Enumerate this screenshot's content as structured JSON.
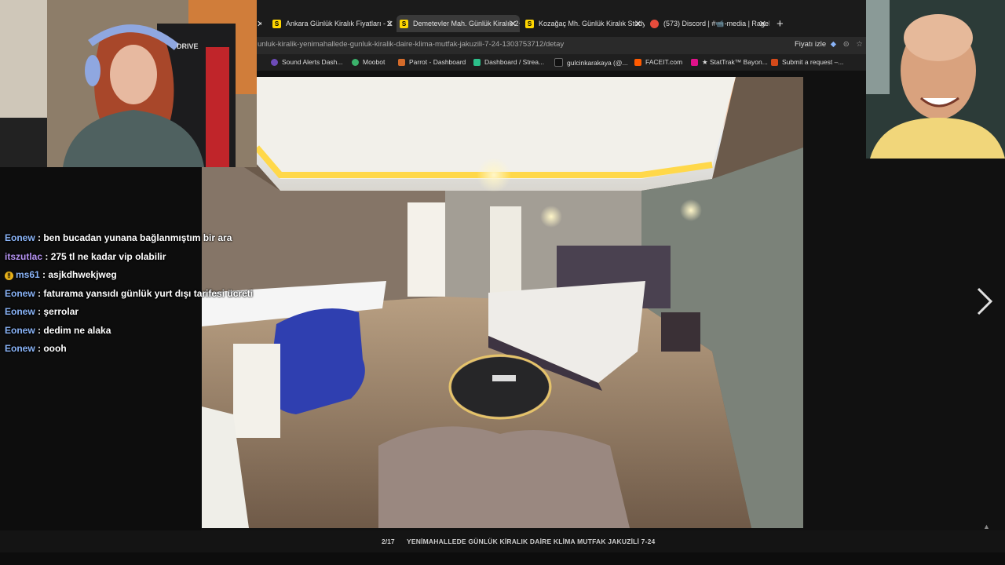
{
  "browser": {
    "tabs": [
      {
        "label": "Ankara Günlük Kiralık Fiyatları - 2",
        "active": false,
        "favicon": "S"
      },
      {
        "label": "Demetevler Mah. Günlük Kiralık 2+",
        "active": true,
        "favicon": "S"
      },
      {
        "label": "Kozağaç Mh. Günlük Kiralık Stüdy",
        "active": false,
        "favicon": "S"
      },
      {
        "label": "(573) Discord | #📹-media | RageK",
        "active": false,
        "favicon": "discord"
      }
    ],
    "url": "unluk-kiralik-yenimahallede-gunluk-kiralik-daire-klima-mutfak-jakuzili-7-24-1303753712/detay",
    "price_watch_label": "Fiyatı izle",
    "bookmarks": [
      "Sound Alerts Dash...",
      "Moobot",
      "Parrot - Dashboard",
      "Dashboard / Strea...",
      "gulcinkarakaya (@...",
      "FACEIT.com",
      "★ StatTrak™ Bayon...",
      "Submit a request –..."
    ]
  },
  "chat": [
    {
      "user": "Eonew",
      "message": "ben bucadan yunana bağlanmıştım bir ara",
      "color": "#8ab4f8"
    },
    {
      "user": "itszutlac",
      "message": "275 tl ne kadar vip olabilir",
      "color": "#b794f4"
    },
    {
      "user": "ms61",
      "message": "asjkdhwekjweg",
      "color": "#8ab4f8"
    },
    {
      "user": "Eonew",
      "message": "faturama yansıdı günlük yurt dışı tarifesi ücreti",
      "color": "#8ab4f8"
    },
    {
      "user": "Eonew",
      "message": "şerrolar",
      "color": "#8ab4f8"
    },
    {
      "user": "Eonew",
      "message": "dedim ne alaka",
      "color": "#8ab4f8"
    },
    {
      "user": "Eonew",
      "message": "oooh",
      "color": "#8ab4f8"
    }
  ],
  "gallery": {
    "counter": "2/17",
    "caption": "YENİMAHALLEDE GÜNLÜK KİRALIK DAİRE KLİMA MUTFAK JAKUZİLİ 7-24"
  },
  "webcam_overlay_text": "DRIVE"
}
